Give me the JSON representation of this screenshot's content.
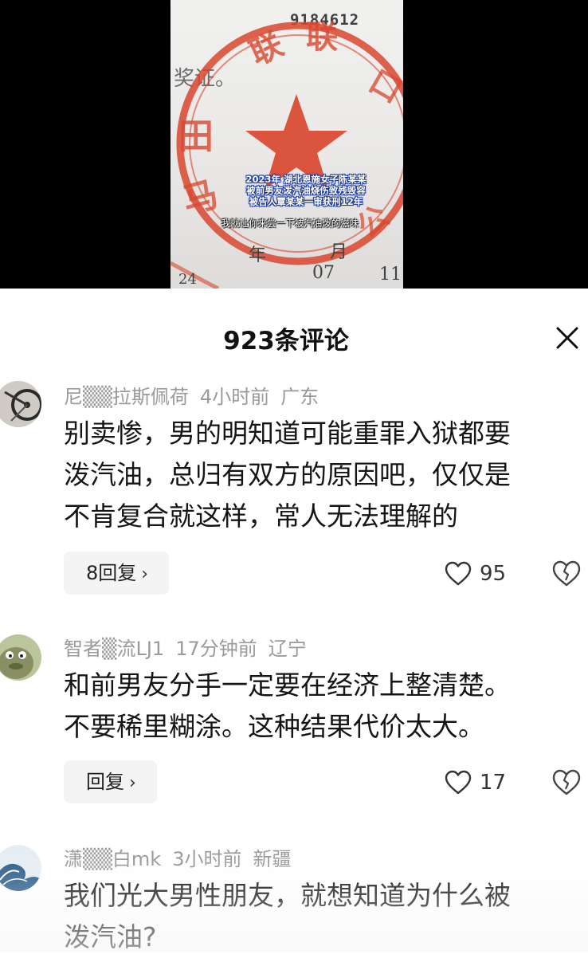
{
  "video": {
    "document_number": "9184612",
    "document_text": "奖证。",
    "stamp_text": "联",
    "stamp_left_text": "田 马",
    "stamp_right_text": "口",
    "date_year": "年",
    "date_month": "月",
    "date_month_value": "07",
    "date_day_value": "11",
    "date_prefix": "24",
    "caption_lines": [
      "2023年 湖北恩施女子陈某某",
      "被前男友泼汽油烧伤致残毁容",
      "被告人覃某某一审获刑12年"
    ],
    "subtitle": "我就让你来尝一下被汽油泼的滋味"
  },
  "sheet": {
    "title": "923条评论",
    "close_icon": "close-icon"
  },
  "comments": [
    {
      "username": "尼▒▒拉斯佩荷",
      "time": "4小时前",
      "location": "广东",
      "lines": [
        "别卖惨，男的明知道可能重罪入狱都要",
        "泼汽油，总归有双方的原因吧，仅仅是",
        "不肯复合就这样，常人无法理解的"
      ],
      "reply_label": "8回复",
      "likes": "95"
    },
    {
      "username": "智者▒流LJ1",
      "time": "17分钟前",
      "location": "辽宁",
      "lines": [
        "和前男友分手一定要在经济上整清楚。",
        "不要稀里糊涂。这种结果代价太大。"
      ],
      "reply_label": "回复",
      "likes": "17"
    },
    {
      "username": "潇▒▒白mk",
      "time": "3小时前",
      "location": "新疆",
      "lines": [
        "我们光大男性朋友，就想知道为什么被",
        "泼汽油?"
      ]
    }
  ],
  "colors": {
    "stamp_red": "#d9472f",
    "caption_outline": "#1c3a9a",
    "meta_gray": "#9a9a9a",
    "pill_bg": "#f4f4f5"
  }
}
